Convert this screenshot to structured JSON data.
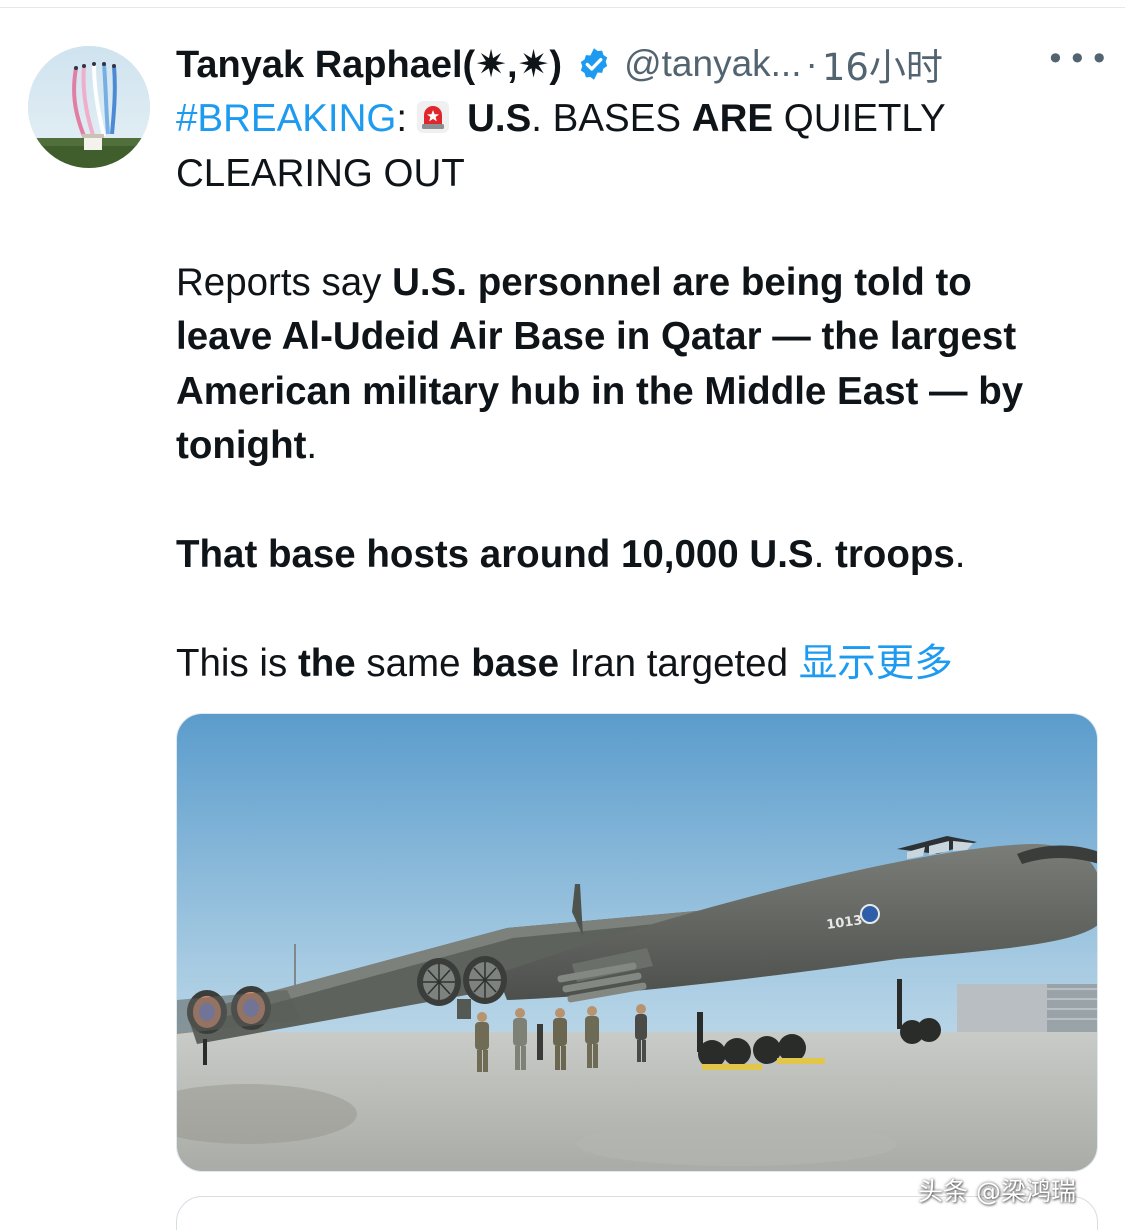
{
  "post": {
    "author_name": "Tanyak Raphael(✷,✷)",
    "handle": "@tanyak...",
    "separator": "·",
    "time": "16小时",
    "more_label": "•••",
    "headline": {
      "hashtag": "#BREAKING",
      "colon": ":",
      "us": "U.S",
      "bases": ". BASES ",
      "are": "ARE",
      "rest": " QUIETLY CLEARING OUT"
    },
    "p1": {
      "lead": "Reports say ",
      "bold": "U.S. personnel are being told to leave Al-Udeid Air Base in Qatar — the largest American military hub in the Middle East — by tonight",
      "end": "."
    },
    "p2": {
      "bold": "That base hosts around 10,000 U.S",
      "end": ". ",
      "bold2": "troops",
      "end2": "."
    },
    "p3": {
      "a": "This is ",
      "b": "the",
      "c": " same ",
      "d": "base",
      "e": " Iran targeted ",
      "show_more": "显示更多"
    },
    "media": {
      "tail_number": "1013"
    },
    "watermark": "头条 @梁鸿瑞"
  },
  "colors": {
    "accent": "#1d9bf0",
    "text": "#0f1419",
    "secondary": "#536471"
  }
}
